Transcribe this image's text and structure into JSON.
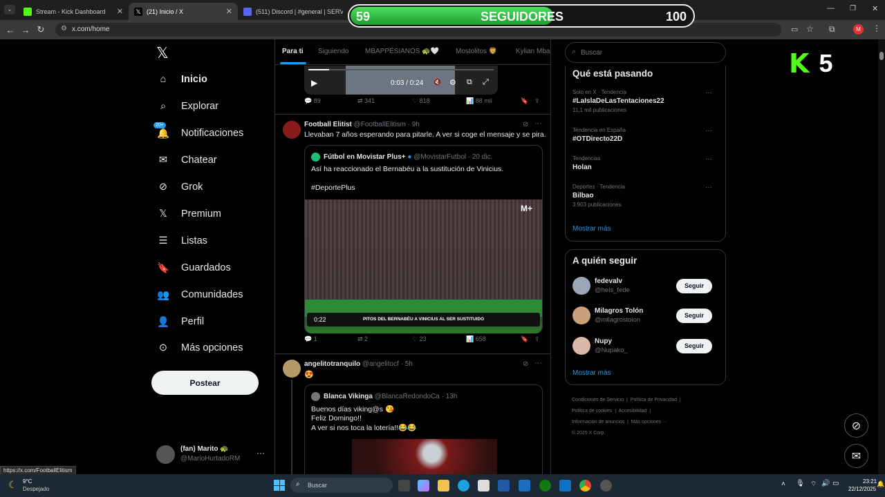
{
  "browser": {
    "tabs": [
      {
        "label": "Stream - Kick Dashboard",
        "favicon_color": "#53fc18"
      },
      {
        "label": "(21) Inicio / X",
        "favicon_color": "#000000"
      },
      {
        "label": "(511) Discord | #general | SERV",
        "favicon_color": "#5865f2"
      }
    ],
    "url": "x.com/home",
    "status_url": "https://x.com/FootballElitism"
  },
  "overlay": {
    "min": "59",
    "label": "SEGUIDORES",
    "max": "100",
    "progress_fraction": 0.59
  },
  "kick_counter": {
    "logo": "K",
    "value": "5"
  },
  "sidebar": {
    "items": [
      {
        "label": "Inicio"
      },
      {
        "label": "Explorar"
      },
      {
        "label": "Notificaciones",
        "badge": "20+"
      },
      {
        "label": "Chatear"
      },
      {
        "label": "Grok"
      },
      {
        "label": "Premium"
      },
      {
        "label": "Listas"
      },
      {
        "label": "Guardados"
      },
      {
        "label": "Comunidades"
      },
      {
        "label": "Perfil"
      },
      {
        "label": "Más opciones"
      }
    ],
    "post_label": "Postear",
    "account": {
      "name": "(fan) Marito 🐢",
      "handle": "@MarioHurtadoRM"
    }
  },
  "feed": {
    "tabs": [
      "Para ti",
      "Siguiendo",
      "MBAPPÉSIANOS 🐢🤍",
      "Mostolitos 🦁",
      "Kylian Mba"
    ],
    "video": {
      "time": "0:03 / 0:24"
    },
    "post0": {
      "replies": "89",
      "reposts": "341",
      "likes": "818",
      "views": "88 mil"
    },
    "post1": {
      "name": "Football Elitist",
      "handle": "@FootballElitism",
      "time": "· 9h",
      "text": "Llevaban 7 años esperando para pitarle. A ver si coge el mensaje y se pira.",
      "quote": {
        "name": "Fútbol en Movistar Plus+",
        "handle": "@MovistarFutbol",
        "time": "· 20 dic.",
        "text": "Así ha reaccionado el Bernabéu a la sustitución de Vinicius.",
        "hashtag": "#DeportePlus",
        "video_caption": "PITOS DEL BERNABÉU A VINICIUS AL SER SUSTITUIDO",
        "video_time": "0:22",
        "brand": "M+"
      },
      "replies": "1",
      "reposts": "2",
      "likes": "23",
      "views": "658"
    },
    "post2": {
      "name": "angelitotranquilo",
      "handle": "@angelitocf",
      "time": "· 5h",
      "text": "😍",
      "quote": {
        "name": "Blanca Vikinga",
        "handle": "@BlancaRedondoCa",
        "time": "· 13h",
        "line1": "Buenos días viking@s 😘",
        "line2": "Feliz Domingo!!",
        "line3": "A ver si nos toca la lotería!!😂😂"
      }
    }
  },
  "right": {
    "search_placeholder": "Buscar",
    "trending_title": "Qué está pasando",
    "trends": [
      {
        "context": "Solo en X · Tendencia",
        "name": "#LaIslaDeLasTentaciones22",
        "count": "11,1 mil publicaciones"
      },
      {
        "context": "Tendencia en España",
        "name": "#OTDirecto22D",
        "count": ""
      },
      {
        "context": "Tendencias",
        "name": "Holan",
        "count": ""
      },
      {
        "context": "Deportes · Tendencia",
        "name": "Bilbao",
        "count": "3.903 publicaciones"
      }
    ],
    "show_more": "Mostrar más",
    "who_title": "A quién seguir",
    "follow": [
      {
        "name": "fedevalv",
        "handle": "@hels_fede",
        "button": "Seguir"
      },
      {
        "name": "Milagros Tolón",
        "handle": "@milagrostolon",
        "button": "Seguir"
      },
      {
        "name": "Nupy",
        "handle": "@Nupako_",
        "button": "Seguir"
      }
    ],
    "show_more2": "Mostrar más",
    "footer": {
      "line1": [
        "Condiciones de Servicio",
        "Política de Privacidad"
      ],
      "line2": [
        "Política de cookies",
        "Accesibilidad"
      ],
      "line3": [
        "Información de anuncios",
        "Más opciones ···"
      ],
      "copyright": "© 2025 X Corp."
    }
  },
  "taskbar": {
    "weather_temp": "9°C",
    "weather_desc": "Despejado",
    "search": "Buscar",
    "time": "23:21",
    "date": "22/12/2025"
  }
}
